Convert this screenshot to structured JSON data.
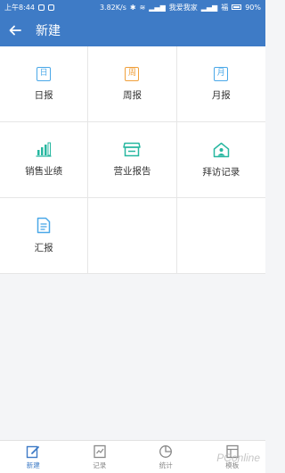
{
  "status_bar": {
    "time": "上午8:44",
    "speed": "3.82K/s",
    "carrier": "我爱我家",
    "carrier2": "福",
    "battery": "90%"
  },
  "header": {
    "title": "新建"
  },
  "grid": [
    {
      "label": "日报",
      "glyph": "日",
      "icon": "day-report-icon",
      "color": "#4aa8e8"
    },
    {
      "label": "周报",
      "glyph": "周",
      "icon": "week-report-icon",
      "color": "#f0a03c"
    },
    {
      "label": "月报",
      "glyph": "月",
      "icon": "month-report-icon",
      "color": "#4aa8e8"
    },
    {
      "label": "销售业绩",
      "icon": "bar-chart-icon",
      "color": "#27b7a0"
    },
    {
      "label": "营业报告",
      "icon": "store-icon",
      "color": "#27b7a0"
    },
    {
      "label": "拜访记录",
      "icon": "home-person-icon",
      "color": "#27b7a0"
    },
    {
      "label": "汇报",
      "icon": "document-icon",
      "color": "#4aa8e8"
    }
  ],
  "tabs": [
    {
      "label": "新建",
      "icon": "edit-icon",
      "active": true
    },
    {
      "label": "记录",
      "icon": "record-icon",
      "active": false
    },
    {
      "label": "统计",
      "icon": "pie-chart-icon",
      "active": false
    },
    {
      "label": "模板",
      "icon": "template-icon",
      "active": false
    }
  ],
  "watermark": "PConline",
  "colors": {
    "primary": "#3e7bc6",
    "accent_blue": "#4aa8e8",
    "accent_teal": "#27b7a0"
  }
}
